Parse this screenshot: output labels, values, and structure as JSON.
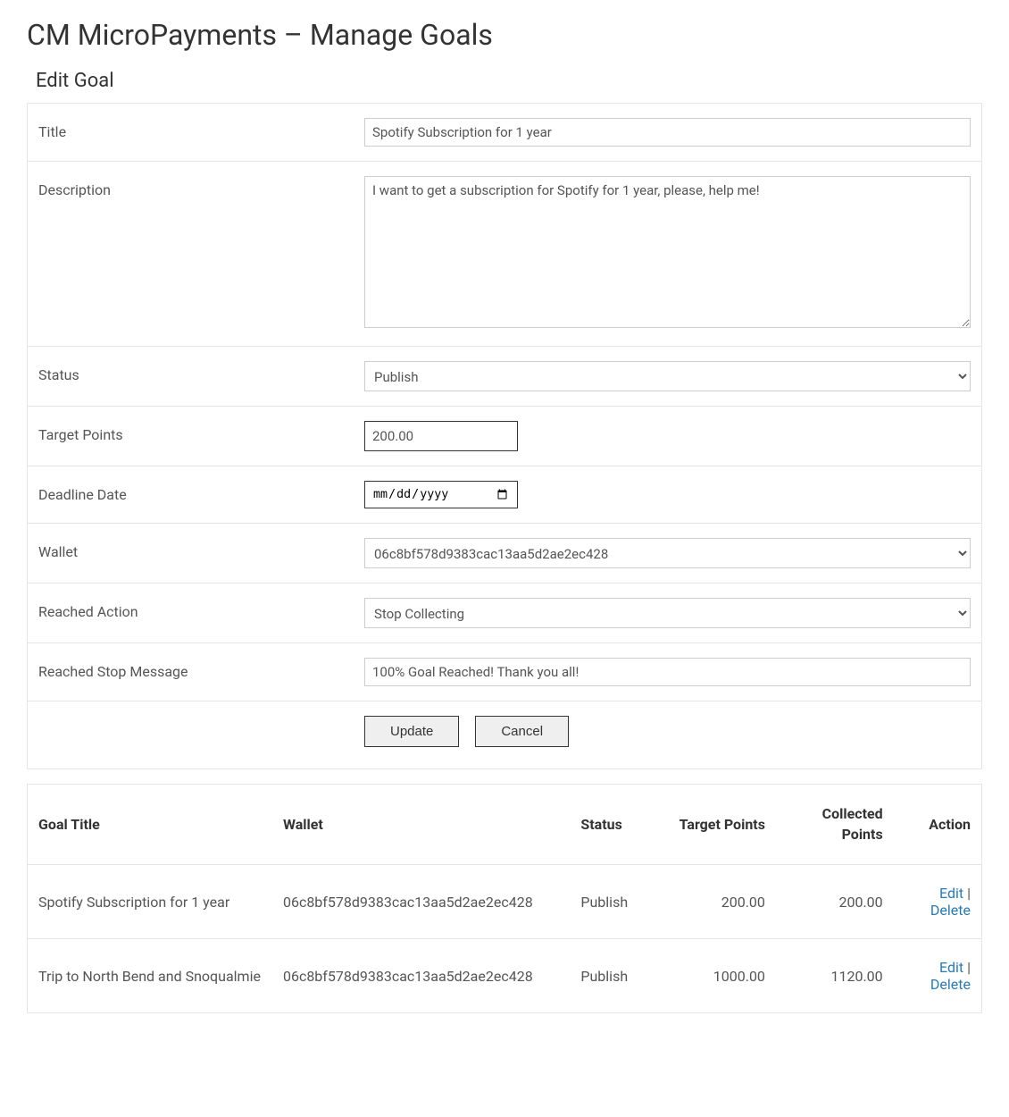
{
  "page": {
    "title": "CM MicroPayments – Manage Goals",
    "section_title": "Edit Goal"
  },
  "form": {
    "labels": {
      "title": "Title",
      "description": "Description",
      "status": "Status",
      "target_points": "Target Points",
      "deadline_date": "Deadline Date",
      "wallet": "Wallet",
      "reached_action": "Reached Action",
      "reached_stop_message": "Reached Stop Message"
    },
    "values": {
      "title": "Spotify Subscription for 1 year",
      "description": "I want to get a subscription for Spotify for 1 year, please, help me!",
      "status": "Publish",
      "target_points": "200.00",
      "deadline_date_placeholder": "mm/dd/yyyy",
      "wallet": "06c8bf578d9383cac13aa5d2ae2ec428",
      "reached_action": "Stop Collecting",
      "reached_stop_message": "100% Goal Reached! Thank you all!"
    },
    "buttons": {
      "update": "Update",
      "cancel": "Cancel"
    }
  },
  "table": {
    "headers": {
      "goal_title": "Goal Title",
      "wallet": "Wallet",
      "status": "Status",
      "target_points": "Target Points",
      "collected_points": "Collected Points",
      "action": "Action"
    },
    "action_labels": {
      "edit": "Edit",
      "delete": "Delete",
      "sep": " | "
    },
    "rows": [
      {
        "title": "Spotify Subscription for 1 year",
        "wallet": "06c8bf578d9383cac13aa5d2ae2ec428",
        "status": "Publish",
        "target_points": "200.00",
        "collected_points": "200.00"
      },
      {
        "title": "Trip to North Bend and Snoqualmie",
        "wallet": "06c8bf578d9383cac13aa5d2ae2ec428",
        "status": "Publish",
        "target_points": "1000.00",
        "collected_points": "1120.00"
      }
    ]
  }
}
